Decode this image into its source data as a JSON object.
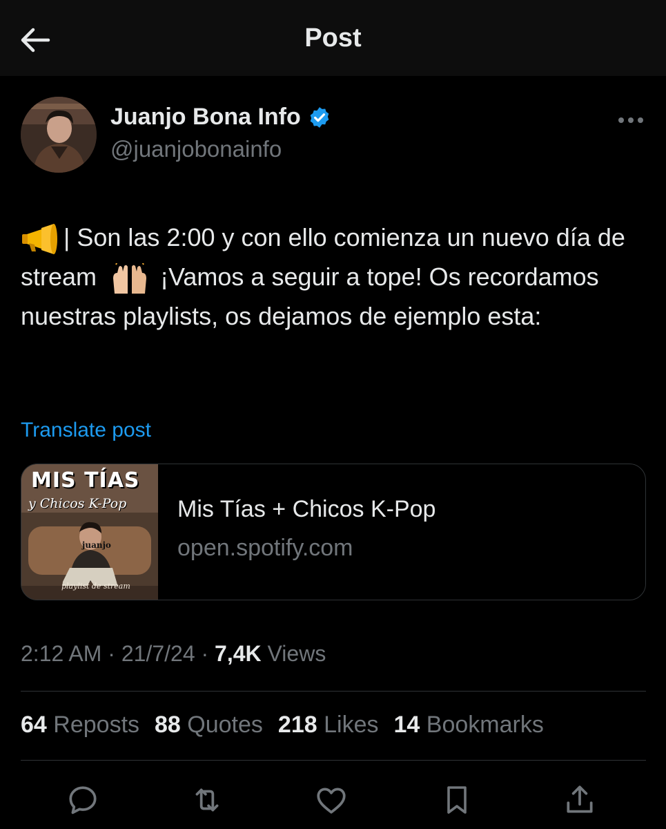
{
  "header": {
    "title": "Post",
    "back_icon": "arrow-left-icon"
  },
  "author": {
    "name": "Juanjo Bona Info",
    "handle": "@juanjobonainfo",
    "verified": true,
    "verified_color": "#1d9bf0"
  },
  "post": {
    "text_part1": "| Son las 2:00 y con ello comienza un nuevo día de stream",
    "text_part2": "¡Vamos a seguir a tope! Os recordamos nuestras playlists, os dejamos de ejemplo esta:",
    "emoji_1": "megaphone-icon",
    "emoji_2": "raising-hands-icon",
    "translate_label": "Translate post"
  },
  "link_card": {
    "title": "Mis Tías + Chicos K-Pop",
    "domain": "open.spotify.com",
    "thumb_title": "MIS TÍAS",
    "thumb_subtitle": "y Chicos K-Pop",
    "thumb_name": "juanjo",
    "thumb_caption": "playlist de stream"
  },
  "meta": {
    "time": "2:12 AM",
    "sep1": " · ",
    "date": "21/7/24",
    "sep2": " · ",
    "views_count": "7,4K",
    "views_label": " Views"
  },
  "stats": [
    {
      "count": "64",
      "label": "Reposts"
    },
    {
      "count": "88",
      "label": "Quotes"
    },
    {
      "count": "218",
      "label": "Likes"
    },
    {
      "count": "14",
      "label": "Bookmarks"
    }
  ],
  "actions": [
    "reply-icon",
    "repost-icon",
    "like-icon",
    "bookmark-icon",
    "share-icon"
  ],
  "colors": {
    "background": "#000000",
    "text": "#e7e9ea",
    "muted": "#71767b",
    "link": "#1d9bf0",
    "border": "#2f3336"
  }
}
